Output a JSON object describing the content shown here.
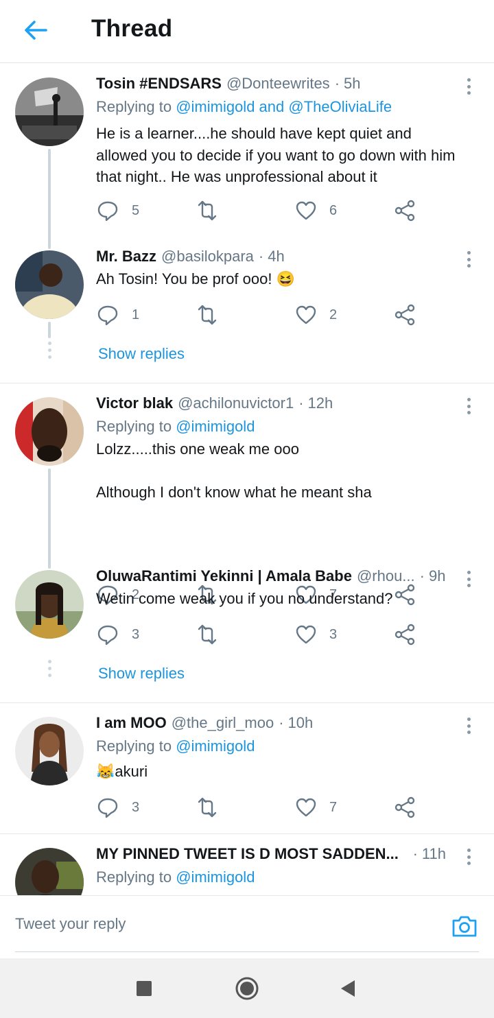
{
  "header": {
    "title": "Thread",
    "back_icon": "arrow-left-icon",
    "accent": "#1da1f2"
  },
  "colors": {
    "link": "#1b95e0",
    "muted": "#657786",
    "text": "#14171a",
    "divider": "#e1e8ed"
  },
  "tweets": [
    {
      "name": "Tosin #ENDSARS",
      "handle": "@Donteewrites",
      "dot": "·",
      "time": "5h",
      "reply_prefix": "Replying to ",
      "reply_mentions": "@imimigold and @TheOliviaLife",
      "text": "He is a learner....he should have kept quiet and allowed you to decide if you want to go down with him that night.. He was unprofessional about it",
      "replies": "5",
      "retweets": "",
      "likes": "6"
    },
    {
      "name": "Mr. Bazz",
      "handle": "@basilokpara",
      "dot": "·",
      "time": "4h",
      "text": "Ah Tosin! You be prof ooo! 😆",
      "replies": "1",
      "retweets": "",
      "likes": "2",
      "show_replies": "Show replies"
    },
    {
      "name": "Victor blak",
      "handle": "@achilonuvictor1",
      "dot": "·",
      "time": "12h",
      "reply_prefix": "Replying to ",
      "reply_mentions": "@imimigold",
      "text": "Lolzz.....this one weak me ooo\n\nAlthough I don't know what he meant sha",
      "replies": "2",
      "retweets": "",
      "likes": "7"
    },
    {
      "name": "OluwaRantimi Yekinni | Amala Babe",
      "handle": "@rhou...",
      "dot": "·",
      "time": "9h",
      "text": "Wetin come weak you if you no understand?",
      "replies": "3",
      "retweets": "",
      "likes": "3",
      "show_replies": "Show replies"
    },
    {
      "name": "I am MOO",
      "handle": "@the_girl_moo",
      "dot": "·",
      "time": "10h",
      "reply_prefix": "Replying to ",
      "reply_mentions": "@imimigold",
      "text": "😹akuri",
      "replies": "3",
      "retweets": "",
      "likes": "7"
    },
    {
      "name": "MY PINNED TWEET IS D MOST SADDEN...",
      "handle": "",
      "dot": "·",
      "time": "11h",
      "reply_prefix": "Replying to ",
      "reply_mentions": "@imimigold"
    }
  ],
  "composer": {
    "placeholder": "Tweet your reply",
    "camera_icon": "camera-icon"
  },
  "navbar": {
    "recents_icon": "square-icon",
    "home_icon": "circle-icon",
    "back_icon": "triangle-back-icon"
  }
}
